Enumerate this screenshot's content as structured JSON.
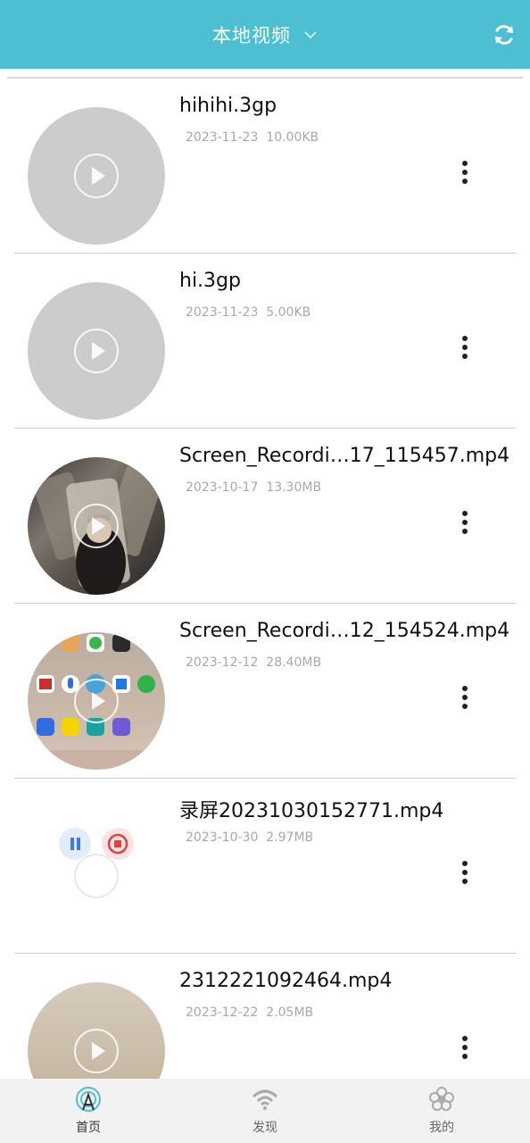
{
  "header": {
    "title": "本地视频",
    "accent_color": "#4cbfd2",
    "icons": {
      "dropdown": "chevron-down-icon",
      "refresh": "refresh-icon"
    }
  },
  "videos": [
    {
      "name": "hihihi.3gp",
      "date": "2023-11-23",
      "size": "10.00KB",
      "thumb": "blank"
    },
    {
      "name": "hi.3gp",
      "date": "2023-11-23",
      "size": "5.00KB",
      "thumb": "blank"
    },
    {
      "name": "Screen_Recordi…17_115457.mp4",
      "date": "2023-10-17",
      "size": "13.30MB",
      "thumb": "dark-photo"
    },
    {
      "name": "Screen_Recordi…12_154524.mp4",
      "date": "2023-12-12",
      "size": "28.40MB",
      "thumb": "app-grid"
    },
    {
      "name": "录屏20231030152771.mp4",
      "date": "2023-10-30",
      "size": "2.97MB",
      "thumb": "recorder-controls"
    },
    {
      "name": "2312221092464.mp4",
      "date": "2023-12-22",
      "size": "2.05MB",
      "thumb": "beige"
    }
  ],
  "nav": {
    "items": [
      {
        "label": "首页",
        "icon": "radar-home-icon",
        "active": true
      },
      {
        "label": "发现",
        "icon": "wifi-icon",
        "active": false
      },
      {
        "label": "我的",
        "icon": "flower-icon",
        "active": false
      }
    ]
  }
}
